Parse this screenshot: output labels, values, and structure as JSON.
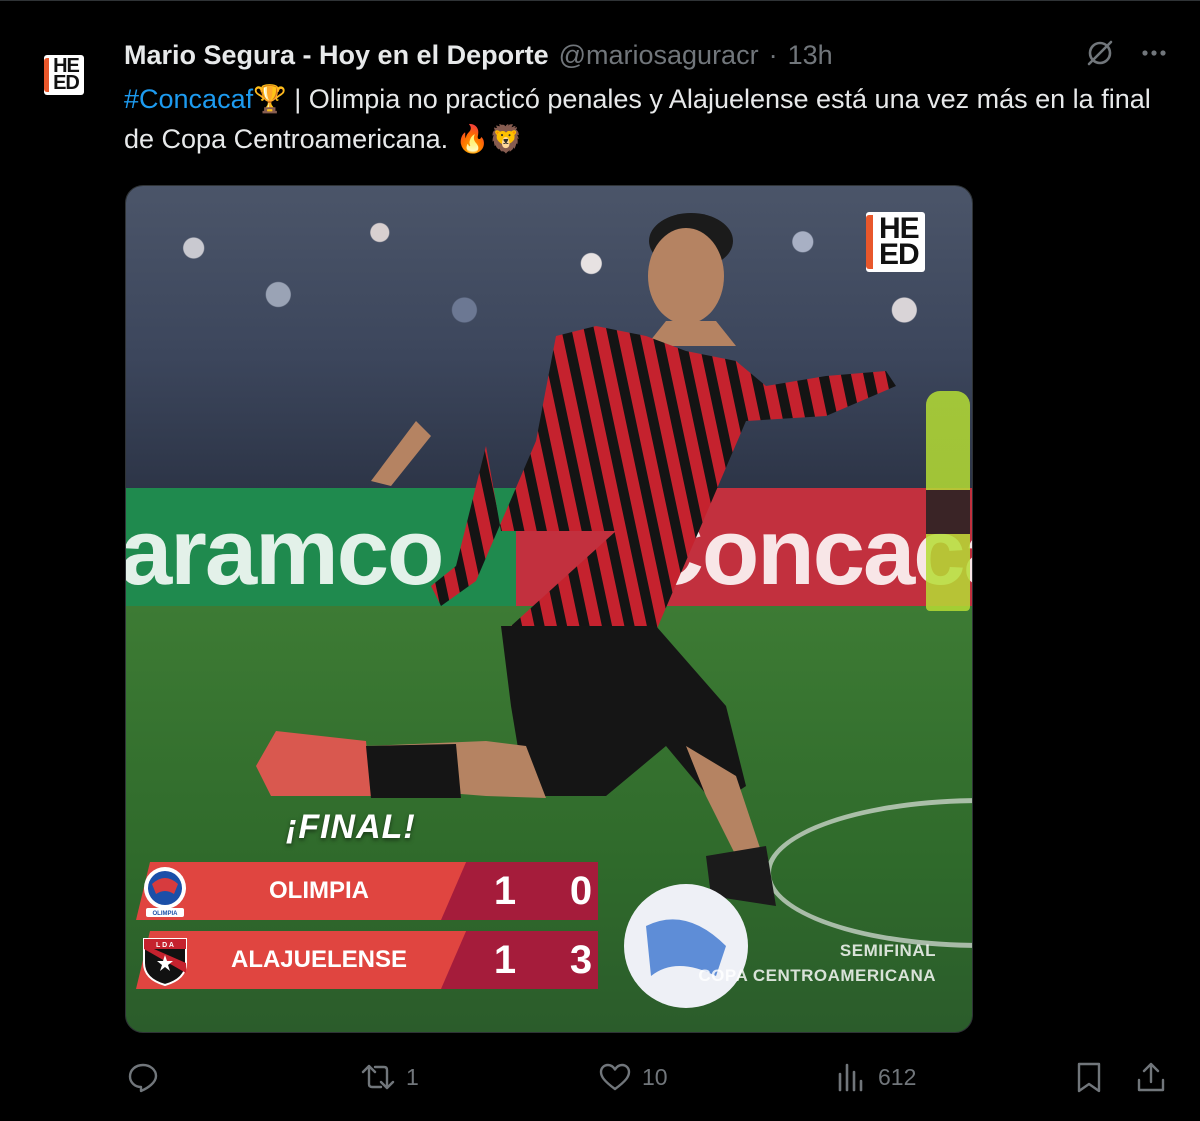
{
  "tweet": {
    "author_name": "Mario Segura - Hoy en el Deporte",
    "handle": "@mariosaguracr",
    "separator": "·",
    "time": "13h",
    "text_hashtag": "#Concacaf",
    "text_trophy": "🏆",
    "text_body": " | Olimpia no practicó penales y Alajuelense está una vez más en la final de Copa Centroamericana. ",
    "text_emojis": "🔥🦁"
  },
  "avatar": {
    "logo_line1": "HE",
    "logo_line2": "ED"
  },
  "media": {
    "logo_line1": "HE",
    "logo_line2": "ED",
    "board_left_text": "aramco",
    "board_right_text": "Concacaf",
    "final_label": "¡FINAL!",
    "rows": [
      {
        "team": "OLIMPIA",
        "score_a": "1",
        "score_b": "0"
      },
      {
        "team": "ALAJUELENSE",
        "score_a": "1",
        "score_b": "3"
      }
    ],
    "stage_line1": "SEMIFINAL",
    "stage_line2": "COPA CENTROAMERICANA",
    "crest_olimpia_text": "OLIMPIA",
    "crest_lda_text": "L D A"
  },
  "actions": {
    "replies": "",
    "retweets": "1",
    "likes": "10",
    "views": "612"
  },
  "colors": {
    "hashtag": "#1d9bf0",
    "team_band": "#e04540",
    "score_band": "#a51c3b",
    "muted": "#71767b"
  },
  "icons": [
    "grok-icon",
    "more-icon",
    "reply-icon",
    "retweet-icon",
    "like-icon",
    "views-icon",
    "bookmark-icon",
    "share-icon"
  ]
}
